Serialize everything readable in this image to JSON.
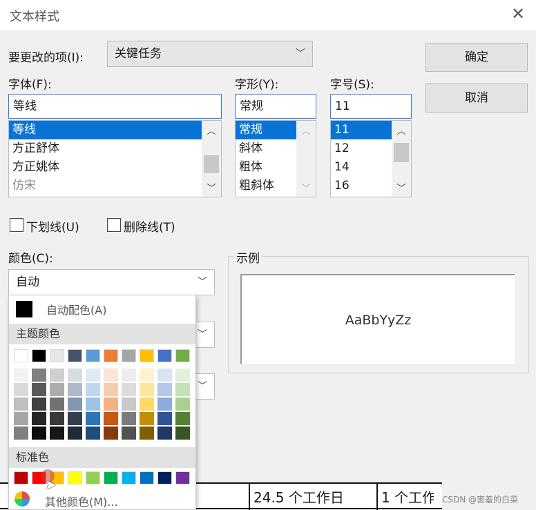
{
  "dialog": {
    "title": "文本样式",
    "close_glyph": "✕",
    "change_item_label": "要更改的项(I):",
    "change_item_value": "关键任务",
    "ok_label": "确定",
    "cancel_label": "取消",
    "font": {
      "label": "字体(F):",
      "value": "等线",
      "items": [
        "等线",
        "方正舒体",
        "方正姚体",
        "仿宋"
      ]
    },
    "style": {
      "label": "字形(Y):",
      "value": "常规",
      "items": [
        "常规",
        "斜体",
        "粗体",
        "粗斜体"
      ]
    },
    "size": {
      "label": "字号(S):",
      "value": "11",
      "items": [
        "11",
        "12",
        "14",
        "16"
      ]
    },
    "underline_label": "下划线(U)",
    "underline_checked": false,
    "strikethrough_label": "删除线(T)",
    "strikethrough_checked": false,
    "color_label": "颜色(C):",
    "color_value": "自动",
    "sample": {
      "label": "示例",
      "text": "AaBbYyZz"
    }
  },
  "color_popup": {
    "auto_label": "自动配色(A)",
    "theme_title": "主题颜色",
    "standard_title": "标准色",
    "more_label": "其他颜色(M)...",
    "theme_top": [
      "#ffffff",
      "#000000",
      "#e7e6e6",
      "#44546a",
      "#5b9bd5",
      "#ed7d31",
      "#a5a5a5",
      "#ffc000",
      "#4472c4",
      "#70ad47"
    ],
    "theme_shades": [
      [
        "#f2f2f2",
        "#d9d9d9",
        "#bfbfbf",
        "#a6a6a6",
        "#808080"
      ],
      [
        "#7f7f7f",
        "#595959",
        "#404040",
        "#262626",
        "#0d0d0d"
      ],
      [
        "#d0cece",
        "#aeabab",
        "#757171",
        "#3a3838",
        "#171616"
      ],
      [
        "#d6dce4",
        "#adb9ca",
        "#8497b0",
        "#333f50",
        "#222a35"
      ],
      [
        "#ddebf7",
        "#bdd7ee",
        "#9dc3e6",
        "#2e75b6",
        "#1f4e79"
      ],
      [
        "#fbe5d6",
        "#f8cbad",
        "#f4b183",
        "#c55a11",
        "#843c0c"
      ],
      [
        "#ededed",
        "#dbdbdb",
        "#c9c9c9",
        "#7b7b7b",
        "#525252"
      ],
      [
        "#fff2cc",
        "#ffe699",
        "#ffd966",
        "#bf8f00",
        "#7f6000"
      ],
      [
        "#dae3f3",
        "#b4c7e7",
        "#8faadc",
        "#2f5597",
        "#203864"
      ],
      [
        "#e2f0d9",
        "#c5e0b4",
        "#a9d18e",
        "#538135",
        "#375623"
      ]
    ],
    "standard": [
      "#c00000",
      "#ff0000",
      "#ffc000",
      "#ffff00",
      "#92d050",
      "#00b050",
      "#00b0f0",
      "#0070c0",
      "#002060",
      "#7030a0"
    ]
  },
  "background_table": {
    "cell_duration": "24.5 个工作日",
    "cell_next": "1 个工作"
  },
  "watermark": "CSDN @害羞的白菜"
}
